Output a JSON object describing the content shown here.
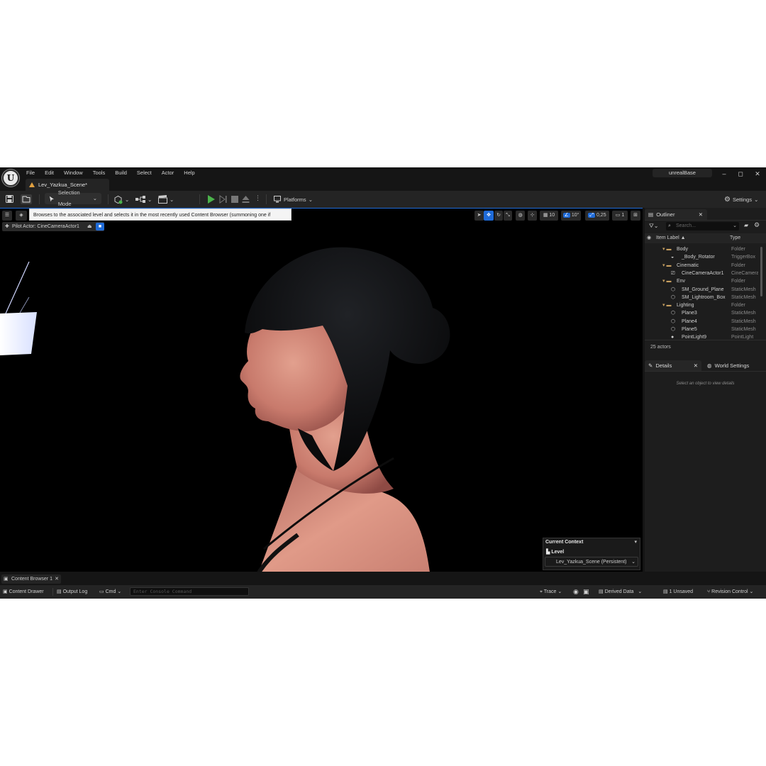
{
  "menu": [
    "File",
    "Edit",
    "Window",
    "Tools",
    "Build",
    "Select",
    "Actor",
    "Help"
  ],
  "level_tab": "Lev_Yazkua_Scene*",
  "project_name": "unrealBase",
  "window_controls": {
    "minimize": "–",
    "maximize": "◻",
    "close": "✕"
  },
  "toolbar": {
    "selection_mode": "Selection Mode",
    "platforms": "Platforms",
    "settings": "Settings"
  },
  "viewport": {
    "tooltip": "Browses to the associated level and selects it in the most recently used Content Browser (summoning one if necessary)",
    "pilot_actor": "Pilot Actor: CineCameraActor1",
    "grid_snap": "10",
    "rotation_snap": "10°",
    "scale_snap": "0,25",
    "camera_speed": "1"
  },
  "current_context": {
    "title": "Current Context",
    "level_label": "Level",
    "level_value": "Lev_Yazkua_Scene (Persistent)"
  },
  "outliner": {
    "tab": "Outliner",
    "search_placeholder": "Search...",
    "col_label": "Item Label ▲",
    "col_type": "Type",
    "rows": [
      {
        "label": "Body",
        "type": "Folder"
      },
      {
        "label": "_Body_Rotator",
        "type": "TriggerBox"
      },
      {
        "label": "Cinematic",
        "type": "Folder"
      },
      {
        "label": "CineCameraActor1",
        "type": "CineCamera"
      },
      {
        "label": "Env",
        "type": "Folder"
      },
      {
        "label": "SM_Ground_Plane",
        "type": "StaticMesh"
      },
      {
        "label": "SM_Lightroom_Box",
        "type": "StaticMesh"
      },
      {
        "label": "Lighting",
        "type": "Folder"
      },
      {
        "label": "Plane3",
        "type": "StaticMesh"
      },
      {
        "label": "Plane4",
        "type": "StaticMesh"
      },
      {
        "label": "Plane5",
        "type": "StaticMesh"
      },
      {
        "label": "PointLight9",
        "type": "PointLight"
      }
    ],
    "actor_count": "25 actors"
  },
  "details": {
    "tab": "Details",
    "world_settings_tab": "World Settings",
    "empty_message": "Select an object to view details"
  },
  "bottom": {
    "content_browser_tab": "Content Browser 1",
    "content_drawer": "Content Drawer",
    "output_log": "Output Log",
    "cmd": "Cmd",
    "console_placeholder": "Enter Console Command",
    "trace": "Trace",
    "derived_data": "Derived Data",
    "unsaved": "1 Unsaved",
    "revision_control": "Revision Control"
  },
  "colors": {
    "accent_blue": "#1f6bd8",
    "play_green": "#4bb34b",
    "folder": "#c8a060"
  }
}
